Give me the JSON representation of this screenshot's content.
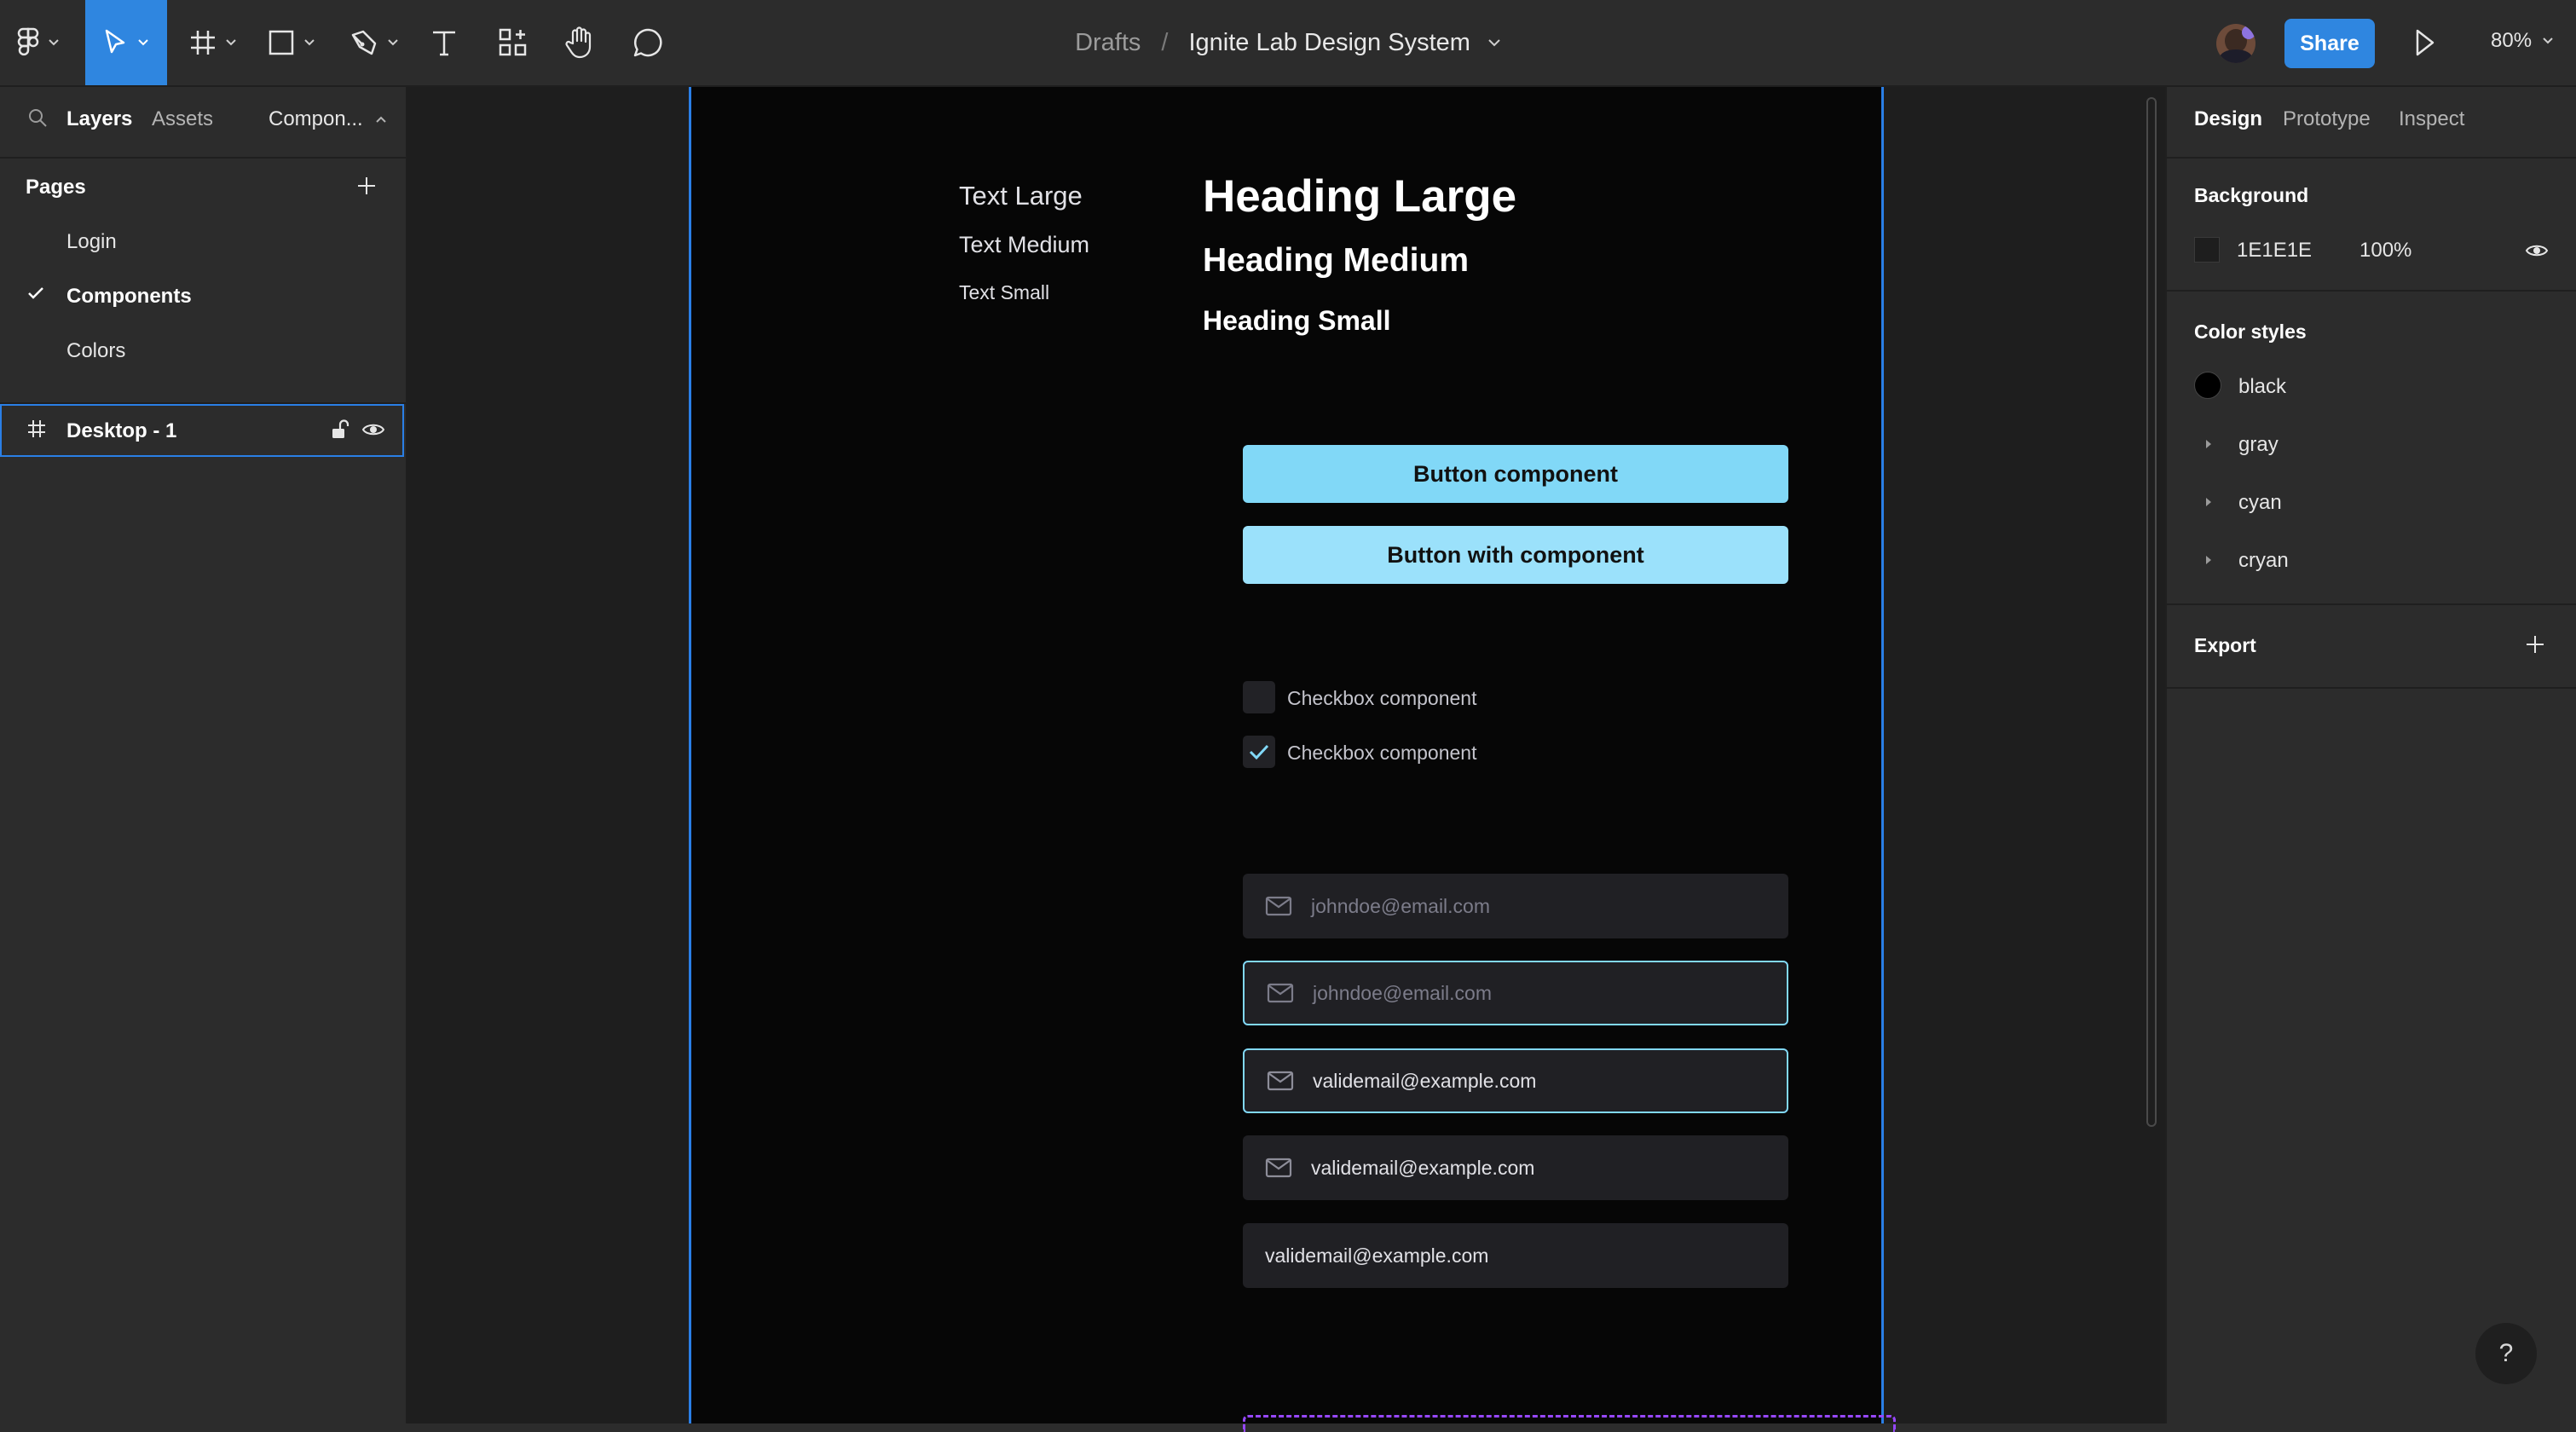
{
  "toolbar": {
    "breadcrumb_parent": "Drafts",
    "breadcrumb_separator": "/",
    "document_title": "Ignite Lab Design System",
    "share_label": "Share",
    "zoom": "80%"
  },
  "left_panel": {
    "tabs": {
      "layers": "Layers",
      "assets": "Assets",
      "page_switcher": "Compon..."
    },
    "pages_heading": "Pages",
    "pages": [
      {
        "label": "Login"
      },
      {
        "label": "Components",
        "current": true
      },
      {
        "label": "Colors"
      }
    ],
    "layer": {
      "label": "Desktop - 1"
    }
  },
  "frame": {
    "text_samples": {
      "large": "Text Large",
      "medium": "Text Medium",
      "small": "Text Small"
    },
    "heading_samples": {
      "large": "Heading Large",
      "medium": "Heading Medium",
      "small": "Heading Small"
    },
    "buttons": [
      "Button component",
      "Button with component"
    ],
    "checkboxes": [
      {
        "label": "Checkbox component",
        "checked": false
      },
      {
        "label": "Checkbox component",
        "checked": true
      }
    ],
    "inputs": [
      {
        "value": "johndoe@email.com",
        "state": "placeholder"
      },
      {
        "value": "johndoe@email.com",
        "state": "focused-placeholder"
      },
      {
        "value": "validemail@example.com",
        "state": "focused-filled"
      },
      {
        "value": "validemail@example.com",
        "state": "filled"
      },
      {
        "value": "validemail@example.com",
        "state": "no-icon"
      }
    ]
  },
  "right_panel": {
    "tabs": {
      "design": "Design",
      "prototype": "Prototype",
      "inspect": "Inspect"
    },
    "background_heading": "Background",
    "background_hex": "1E1E1E",
    "background_opacity": "100%",
    "color_styles_heading": "Color styles",
    "color_styles": [
      {
        "name": "black"
      },
      {
        "name": "gray"
      },
      {
        "name": "cyan"
      },
      {
        "name": "cryan"
      }
    ],
    "export_heading": "Export",
    "help_label": "?"
  },
  "colors": {
    "accent_blue": "#2f86e0",
    "button_cyan": "#81d8f7",
    "input_bg": "#202024",
    "frame_bg": "#060606",
    "canvas_bg": "#1e1e1e"
  }
}
